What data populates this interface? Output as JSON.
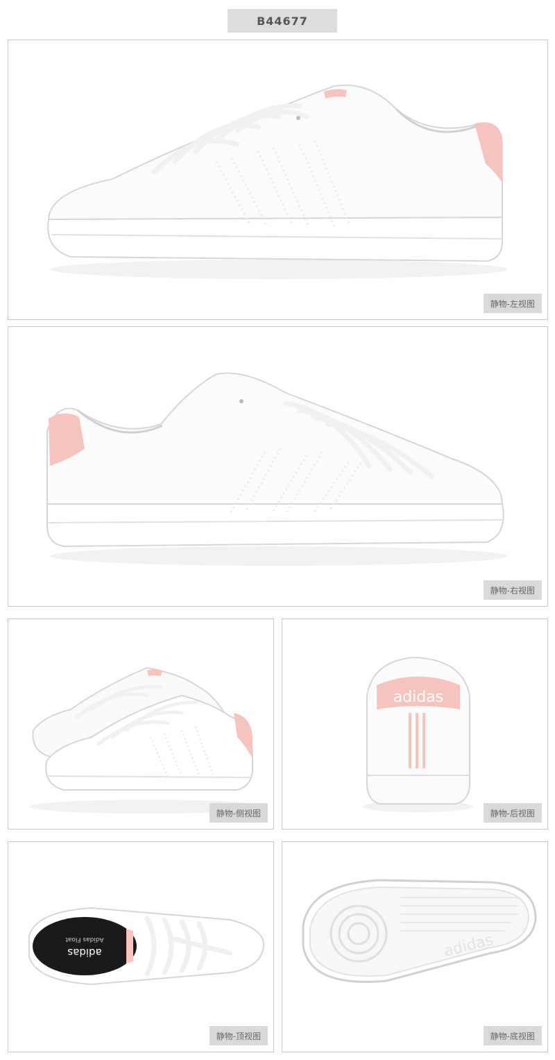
{
  "product": {
    "code": "B44677"
  },
  "views": [
    {
      "label": "静物-左视图",
      "icon": "sneaker-left-view"
    },
    {
      "label": "静物-右视图",
      "icon": "sneaker-right-view"
    },
    {
      "label": "静物-侧视图",
      "icon": "sneaker-pair-side-view"
    },
    {
      "label": "静物-后视图",
      "icon": "sneaker-back-view"
    },
    {
      "label": "静物-顶视图",
      "icon": "sneaker-top-view"
    },
    {
      "label": "静物-底视图",
      "icon": "sneaker-bottom-view"
    }
  ],
  "brand": {
    "name": "adidas",
    "insole_text": "adidas",
    "insole_subtext": "Adidas Float"
  },
  "colors": {
    "upper": "#ffffff",
    "heel_tab": "#f7c4bd",
    "shadow": "#e6e6e6",
    "outline": "#d6d6d6"
  }
}
